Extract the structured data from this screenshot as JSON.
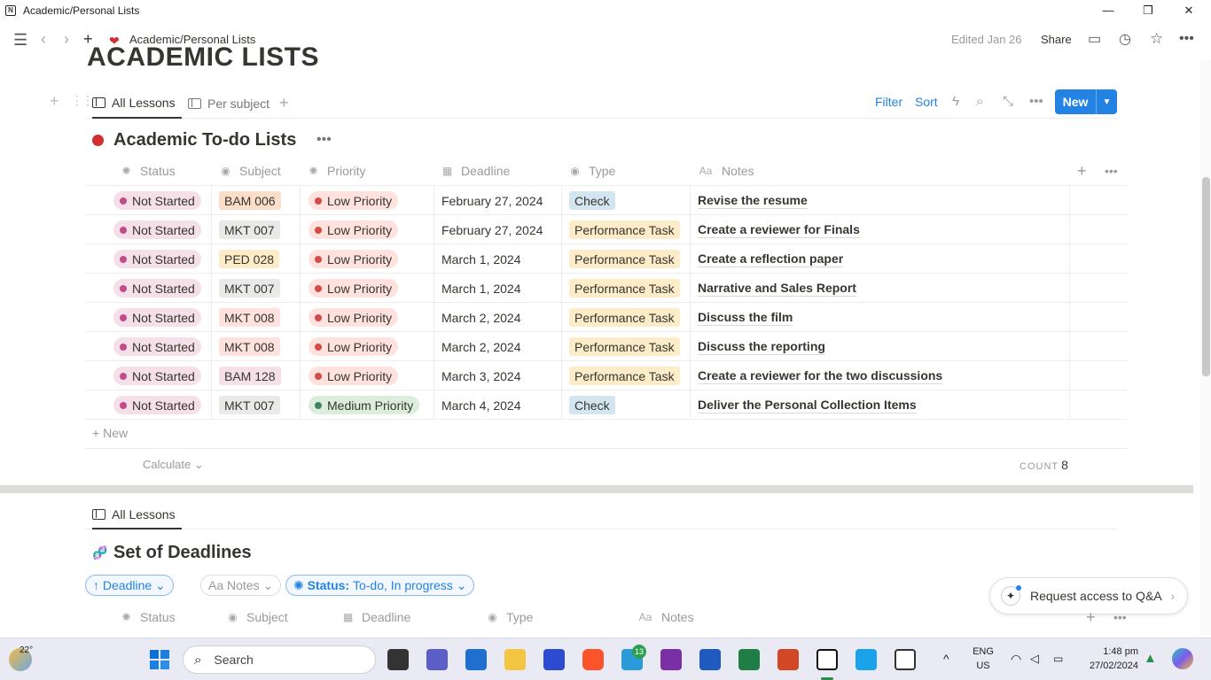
{
  "window": {
    "title": "Academic/Personal Lists",
    "controls": [
      "—",
      "❐",
      "✕"
    ]
  },
  "topbar": {
    "breadcrumb": "Academic/Personal Lists",
    "edited": "Edited Jan 26",
    "share": "Share"
  },
  "page": {
    "title": "ACADEMIC LISTS"
  },
  "view_tabs": [
    {
      "label": "All Lessons"
    },
    {
      "label": "Per subject"
    }
  ],
  "toolbar": {
    "filter": "Filter",
    "sort": "Sort",
    "new": "New"
  },
  "db1": {
    "title": "Academic To-do Lists",
    "columns": [
      "Status",
      "Subject",
      "Priority",
      "Deadline",
      "Type",
      "Notes"
    ],
    "rows": [
      {
        "status": "Not Started",
        "subject": "BAM 006",
        "subject_color": "#fadec9",
        "priority": "Low Priority",
        "priority_kind": "low",
        "deadline": "February 27, 2024",
        "type": "Check",
        "type_kind": "check",
        "notes": "Revise the resume"
      },
      {
        "status": "Not Started",
        "subject": "MKT 007",
        "subject_color": "#e9e9e7",
        "priority": "Low Priority",
        "priority_kind": "low",
        "deadline": "February 27, 2024",
        "type": "Performance Task",
        "type_kind": "task",
        "notes": "Create a reviewer for Finals"
      },
      {
        "status": "Not Started",
        "subject": "PED 028",
        "subject_color": "#fdecc8",
        "priority": "Low Priority",
        "priority_kind": "low",
        "deadline": "March 1, 2024",
        "type": "Performance Task",
        "type_kind": "task",
        "notes": "Create a reflection paper"
      },
      {
        "status": "Not Started",
        "subject": "MKT 007",
        "subject_color": "#e9e9e7",
        "priority": "Low Priority",
        "priority_kind": "low",
        "deadline": "March 1, 2024",
        "type": "Performance Task",
        "type_kind": "task",
        "notes": "Narrative and Sales Report"
      },
      {
        "status": "Not Started",
        "subject": "MKT 008",
        "subject_color": "#ffe2dd",
        "priority": "Low Priority",
        "priority_kind": "low",
        "deadline": "March 2, 2024",
        "type": "Performance Task",
        "type_kind": "task",
        "notes": "Discuss the film"
      },
      {
        "status": "Not Started",
        "subject": "MKT 008",
        "subject_color": "#ffe2dd",
        "priority": "Low Priority",
        "priority_kind": "low",
        "deadline": "March 2, 2024",
        "type": "Performance Task",
        "type_kind": "task",
        "notes": "Discuss the reporting"
      },
      {
        "status": "Not Started",
        "subject": "BAM 128",
        "subject_color": "#f5e0e9",
        "priority": "Low Priority",
        "priority_kind": "low",
        "deadline": "March 3, 2024",
        "type": "Performance Task",
        "type_kind": "task",
        "notes": "Create a reviewer for the two discussions"
      },
      {
        "status": "Not Started",
        "subject": "MKT 007",
        "subject_color": "#e9e9e7",
        "priority": "Medium Priority",
        "priority_kind": "medium",
        "deadline": "March 4, 2024",
        "type": "Check",
        "type_kind": "check",
        "notes": "Deliver the Personal Collection Items"
      }
    ],
    "add_row": "New",
    "calculate": "Calculate",
    "count_label": "COUNT",
    "count_value": "8"
  },
  "db2": {
    "tab": "All Lessons",
    "title": "Set of Deadlines",
    "filters": [
      {
        "label": "Deadline",
        "icon": "↑",
        "kind": "blue"
      },
      {
        "label": "Notes",
        "icon": "Aa",
        "kind": "grey"
      },
      {
        "label_bold": "Status:",
        "label": "To-do, In progress",
        "kind": "blue"
      }
    ],
    "columns": [
      "Status",
      "Subject",
      "Deadline",
      "Type",
      "Notes"
    ]
  },
  "request_access": "Request access to Q&A",
  "taskbar": {
    "weather": "22°",
    "search": "Search",
    "badge": "13",
    "lang1": "ENG",
    "lang2": "US",
    "time": "1:48 pm",
    "date": "27/02/2024"
  },
  "colors": {
    "accent": "#2383e2",
    "status_pill": "#f5e0e9",
    "status_dot": "#c14c8a",
    "low_pill": "#ffe2dd",
    "low_dot": "#d44c47",
    "medium_pill": "#dbeddb",
    "medium_dot": "#448361",
    "check_tag": "#d3e5ef",
    "task_tag": "#fdecc8"
  }
}
